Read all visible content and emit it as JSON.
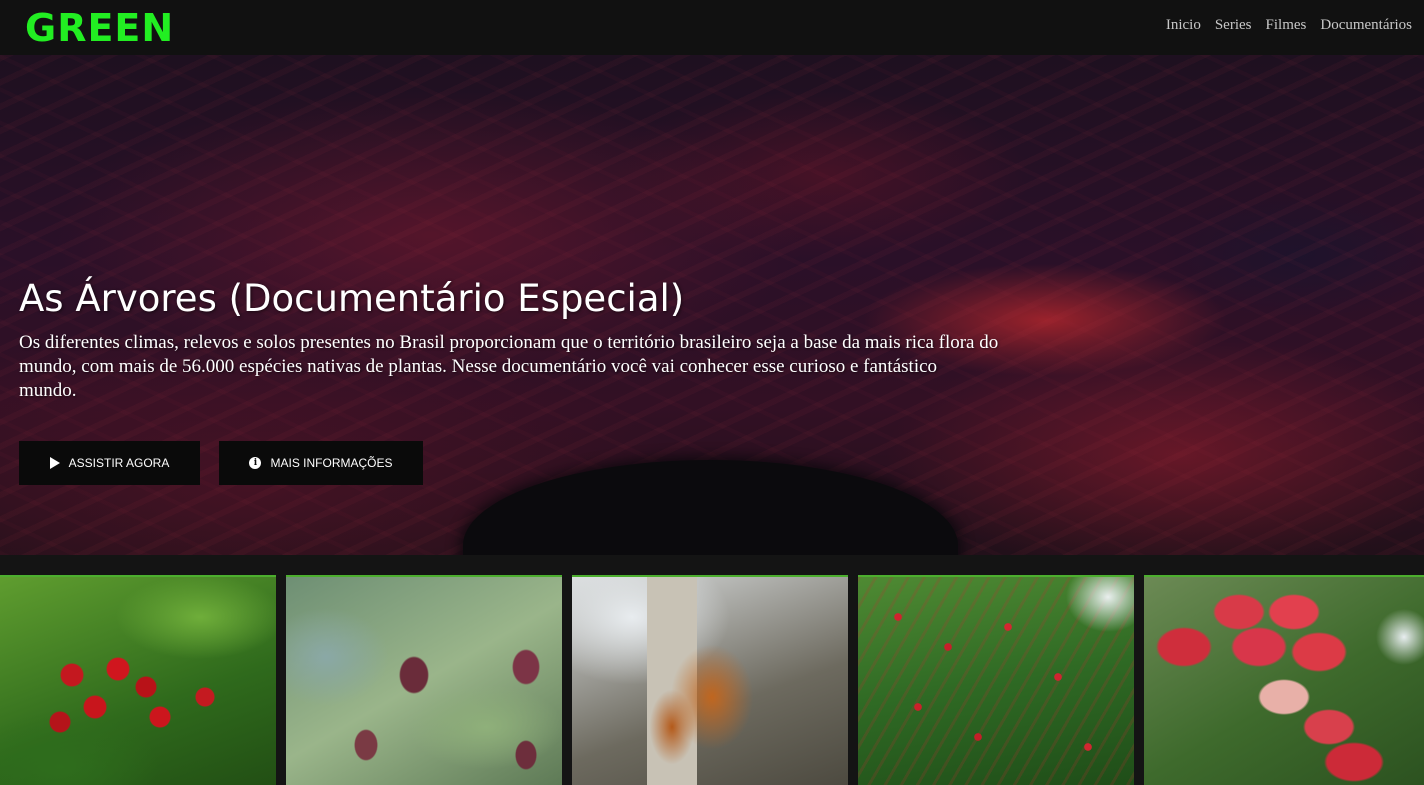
{
  "header": {
    "logo": "GREEN",
    "logo_color": "#22ee22",
    "nav": [
      "Inicio",
      "Series",
      "Filmes",
      "Documentários"
    ]
  },
  "hero": {
    "title": "As Árvores (Documentário Especial)",
    "description": "Os diferentes climas, relevos e solos presentes no Brasil proporcionam que o território brasileiro seja a base da mais rica flora do mundo, com mais de 56.000 espécies nativas de plantas. Nesse documentário você vai conhecer esse curioso e fantástico mundo.",
    "play_button": "ASSISTIR AGORA",
    "info_button": "MAIS INFORMAÇÕES",
    "play_icon": "play-icon",
    "info_icon": "info-icon"
  },
  "row": {
    "accent": "#4caf2e",
    "items": [
      {
        "image": "acerola-fruits-image"
      },
      {
        "image": "figs-image"
      },
      {
        "image": "palm-fruits-image"
      },
      {
        "image": "lychee-tree-image"
      },
      {
        "image": "jambo-fruits-image"
      }
    ]
  }
}
